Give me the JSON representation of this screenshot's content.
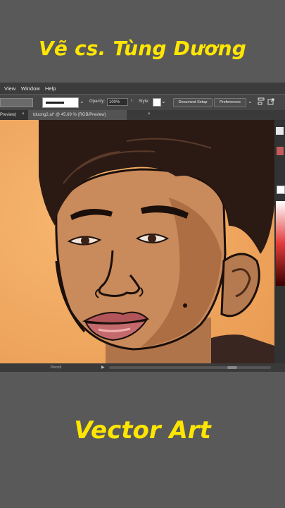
{
  "captions": {
    "top": "Vẽ cs. Tùng Dương",
    "bottom": "Vector Art"
  },
  "menu": [
    "View",
    "Window",
    "Help"
  ],
  "control_bar": {
    "opacity_label": "Opacity:",
    "opacity_value": "100%",
    "style_label": "Style:",
    "document_setup": "Document Setup",
    "preferences": "Preferences"
  },
  "tabs": [
    {
      "label": "Preview)",
      "close": "×"
    },
    {
      "label": "tduong2.ai* @ 45.69 % (RGB/Preview)",
      "close": "×"
    }
  ],
  "status": {
    "tool": "Pencil"
  },
  "colors": {
    "caption": "#ffe600",
    "background": "#595959",
    "artboard_bg": "#f0a55a",
    "hair": "#2b1a14",
    "skin": "#c98a5c",
    "lips": "#c46a6c"
  },
  "icons": [
    "chevron-down-icon",
    "chevron-right-icon",
    "arrange-icon",
    "export-icon",
    "play-icon"
  ]
}
